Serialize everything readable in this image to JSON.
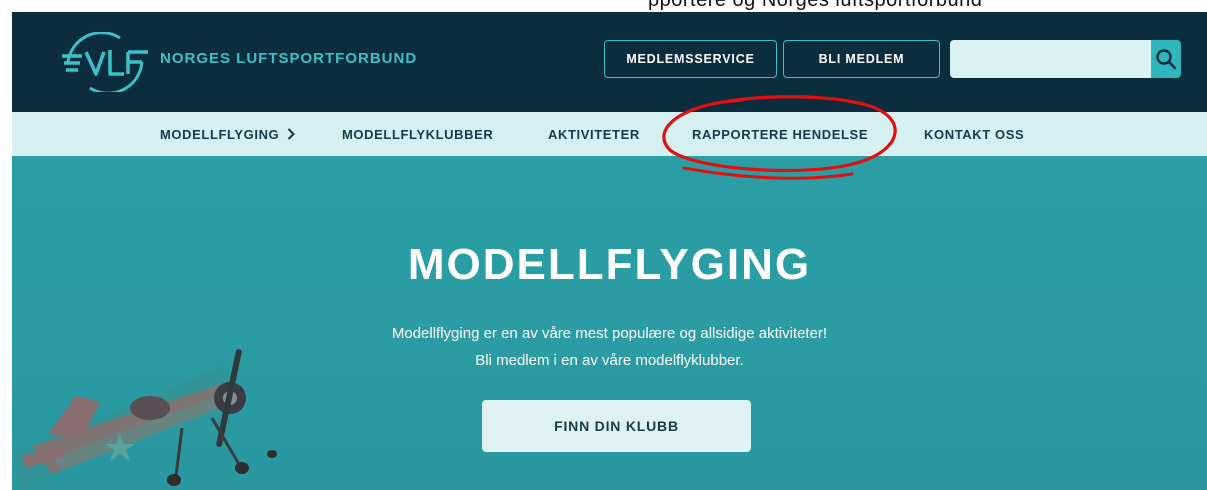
{
  "top_strip": {
    "text": "pportere og Norges luftsportforbund"
  },
  "header": {
    "brand": "NORGES LUFTSPORTFORBUND",
    "buttons": {
      "member_service": "MEDLEMSSERVICE",
      "join": "BLI MEDLEM"
    },
    "search": {
      "value": "",
      "icon": "search-icon"
    },
    "logo": "nlf-logo"
  },
  "nav": {
    "items": [
      {
        "label": "MODELLFLYGING",
        "has_chevron": true
      },
      {
        "label": "MODELLFLYKLUBBER"
      },
      {
        "label": "AKTIVITETER"
      },
      {
        "label": "RAPPORTERE HENDELSE",
        "highlighted": true
      },
      {
        "label": "KONTAKT OSS"
      }
    ]
  },
  "hero": {
    "title": "MODELLFLYGING",
    "line1": "Modellflyging er en av våre mest populære og allsidige aktiviteter!",
    "line2": "Bli medlem i en av våre modelflyklubber.",
    "cta": "FINN DIN KLUBB"
  },
  "colors": {
    "header_bg": "#0b2d3e",
    "accent": "#3ec0c8",
    "nav_bg": "#d6eff0",
    "hero_bg": "#2a9ea4",
    "annotation": "#e01010"
  }
}
